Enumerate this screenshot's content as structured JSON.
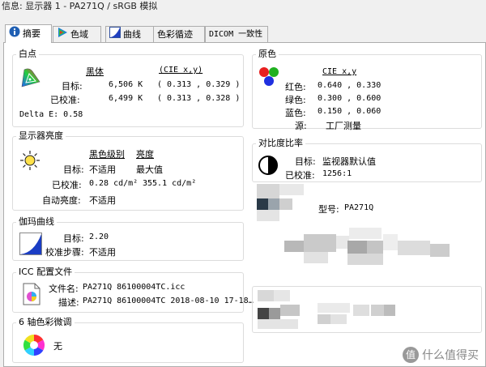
{
  "window": {
    "title": "信息: 显示器 1 - PA271Q / sRGB 模拟"
  },
  "tabs": [
    {
      "label": "摘要",
      "icon": "info-icon"
    },
    {
      "label": "色域",
      "icon": "gamut-icon"
    },
    {
      "label": "曲线",
      "icon": "curve-icon"
    },
    {
      "label": "色彩循迹",
      "icon": ""
    },
    {
      "label": "DICOM 一致性",
      "icon": ""
    }
  ],
  "whitepoint": {
    "title": "白点",
    "col_blackbody": "黑体",
    "col_cie": "(CIE x,y)",
    "target_label": "目标:",
    "target_k": "6,506 K",
    "target_xy": "( 0.313 , 0.329 )",
    "calibrated_label": "已校准:",
    "calibrated_k": "6,499 K",
    "calibrated_xy": "( 0.313 , 0.328 )",
    "delta_e": "Delta E: 0.58"
  },
  "brightness": {
    "title": "显示器亮度",
    "col_black": "黑色级别",
    "col_brightness": "亮度",
    "target_label": "目标:",
    "target_black": "不适用",
    "target_brightness": "最大值",
    "calibrated_label": "已校准:",
    "calibrated_black": "0.28 cd/m²",
    "calibrated_brightness": "355.1 cd/m²",
    "auto_label": "自动亮度:",
    "auto_value": "不适用"
  },
  "gamma": {
    "title": "伽玛曲线",
    "target_label": "目标:",
    "target_value": "2.20",
    "steps_label": "校准步骤:",
    "steps_value": "不适用"
  },
  "icc": {
    "title": "ICC 配置文件",
    "filename_label": "文件名:",
    "filename_value": "PA271Q 86100004TC.icc",
    "desc_label": "描述:",
    "desc_value": "PA271Q 86100004TC 2018-08-10 17-18…"
  },
  "six_axis": {
    "title": "6 轴色彩微调",
    "value": "无"
  },
  "primaries": {
    "title": "原色",
    "col_cie": "CIE x,y",
    "red_label": "红色:",
    "red_value": "0.640 , 0.330",
    "green_label": "绿色:",
    "green_value": "0.300 , 0.600",
    "blue_label": "蓝色:",
    "blue_value": "0.150 , 0.060",
    "source_label": "源:",
    "source_value": "工厂测量"
  },
  "contrast": {
    "title": "对比度比率",
    "target_label": "目标:",
    "target_value": "监视器默认值",
    "calibrated_label": "已校准:",
    "calibrated_value": "1256:1"
  },
  "model": {
    "label": "型号:",
    "value": "PA271Q"
  },
  "watermark": {
    "text": "什么值得买",
    "glyph": "值"
  }
}
